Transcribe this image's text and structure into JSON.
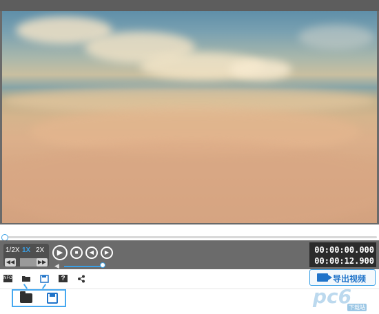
{
  "player": {
    "speeds": [
      "1/2X",
      "1X",
      "2X"
    ],
    "active_speed": "1X",
    "current_time": "00:00:00.000",
    "total_time": "00:00:12.900",
    "progress": 0.0,
    "volume": 0.9
  },
  "toolbar": {
    "icons": [
      "video-info-icon",
      "open-folder-icon",
      "save-icon",
      "help-icon",
      "share-icon"
    ],
    "export_label": "导出视频"
  },
  "callout": {
    "icons": [
      "open-folder-icon",
      "save-icon"
    ]
  },
  "watermark": {
    "logo_text": "pc6",
    "sub_text": "下载站"
  },
  "colors": {
    "accent": "#3aa0e6",
    "export_blue": "#1f73c9",
    "control_bg": "#6b6b6b",
    "time_bg": "#2b2b2b"
  }
}
